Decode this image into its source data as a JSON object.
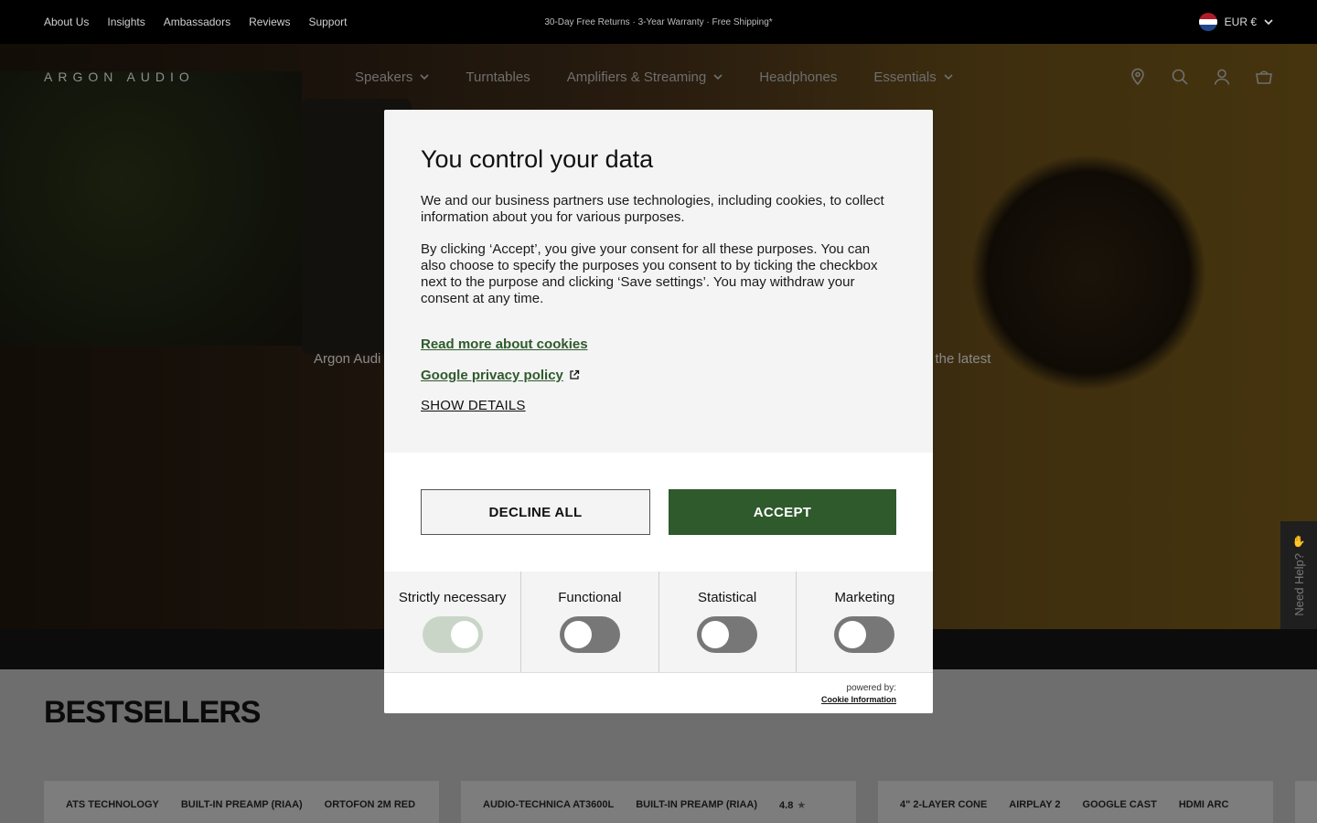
{
  "topbar": {
    "links": [
      "About Us",
      "Insights",
      "Ambassadors",
      "Reviews",
      "Support"
    ],
    "promo": "30-Day Free Returns · 3-Year Warranty · Free Shipping*",
    "currency": "EUR €"
  },
  "nav": {
    "logo": "ARGON AUDIO",
    "menu": [
      {
        "label": "Speakers",
        "dropdown": true
      },
      {
        "label": "Turntables",
        "dropdown": false
      },
      {
        "label": "Amplifiers & Streaming",
        "dropdown": true
      },
      {
        "label": "Headphones",
        "dropdown": false
      },
      {
        "label": "Essentials",
        "dropdown": true
      }
    ],
    "icons": [
      "location-icon",
      "search-icon",
      "account-icon",
      "cart-icon"
    ]
  },
  "hero": {
    "tagline_left": "Argon Audi",
    "tagline_right": "g the latest"
  },
  "bestsellers": {
    "title": "BESTSELLERS",
    "cards": [
      {
        "tags": [
          "ATS TECHNOLOGY",
          "BUILT-IN PREAMP (RIAA)",
          "ORTOFON 2M RED"
        ]
      },
      {
        "tags": [
          "AUDIO-TECHNICA AT3600L",
          "BUILT-IN PREAMP (RIAA)"
        ],
        "rating": "4.8"
      },
      {
        "tags": [
          "4\" 2-LAYER CONE",
          "AIRPLAY 2",
          "GOOGLE CAST",
          "HDMI ARC"
        ]
      }
    ]
  },
  "need_help": "Need Help?",
  "consent": {
    "title": "You control your data",
    "para1": "We and our business partners use technologies, including cookies, to collect information about you for various purposes.",
    "para2": "By clicking ‘Accept’, you give your consent for all these purposes. You can also choose to specify the purposes you consent to by ticking the checkbox next to the purpose and clicking ‘Save settings’. You may withdraw your consent at any time.",
    "read_more": "Read more about cookies",
    "google_policy": "Google privacy policy",
    "show_details": "SHOW DETAILS",
    "decline": "DECLINE ALL",
    "accept": "ACCEPT",
    "categories": [
      {
        "label": "Strictly necessary",
        "enabled": true
      },
      {
        "label": "Functional",
        "enabled": false
      },
      {
        "label": "Statistical",
        "enabled": false
      },
      {
        "label": "Marketing",
        "enabled": false
      }
    ],
    "powered_by": "powered by:",
    "provider": "Cookie Information"
  },
  "colors": {
    "accent_green": "#2e5a2c",
    "link_green": "#2f5b2c"
  }
}
